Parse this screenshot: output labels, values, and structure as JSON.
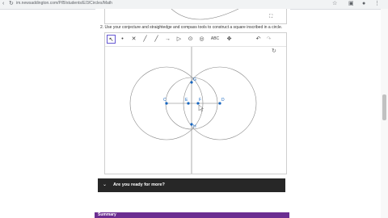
{
  "browser": {
    "url": "im.newsaddington.com/P/B/students/E/3/Circles/Math",
    "back_icon": "arrow-left-icon",
    "forward_icon": "arrow-right-icon",
    "reload_icon": "reload-icon"
  },
  "question": {
    "text": "2. Use your conjecture and straightedge and compass tools to construct a square inscribed in a circle."
  },
  "applet": {
    "tools": [
      {
        "name": "move-tool-icon",
        "glyph": "↖"
      },
      {
        "name": "point-tool-icon",
        "glyph": "•"
      },
      {
        "name": "intersect-tool-icon",
        "glyph": "✕"
      },
      {
        "name": "line-tool-icon",
        "glyph": "╱"
      },
      {
        "name": "segment-tool-icon",
        "glyph": "╱"
      },
      {
        "name": "ray-tool-icon",
        "glyph": "→"
      },
      {
        "name": "polygon-tool-icon",
        "glyph": "▷"
      },
      {
        "name": "circle-tool-icon",
        "glyph": "⊙"
      },
      {
        "name": "compass-tool-icon",
        "glyph": "◎"
      },
      {
        "name": "text-tool-icon",
        "glyph": "ABC"
      },
      {
        "name": "move-view-tool-icon",
        "glyph": "✥"
      }
    ],
    "undo_icon": "undo-icon",
    "redo_icon": "redo-icon",
    "refresh_icon": "refresh-icon",
    "fullscreen_icon": "fullscreen-icon",
    "points": [
      {
        "label": "C",
        "color": "#1565c0"
      },
      {
        "label": "E",
        "color": "#1565c0"
      },
      {
        "label": "F",
        "color": "#1565c0"
      },
      {
        "label": "D",
        "color": "#1565c0"
      },
      {
        "label": "G",
        "color": "#1565c0"
      },
      {
        "label": "H",
        "color": "#1565c0"
      }
    ]
  },
  "ready": {
    "label": "Are you ready for more?",
    "chevron_icon": "chevron-down-icon"
  },
  "summary": {
    "label": "Summary"
  },
  "colors": {
    "ready_bg": "#272727",
    "summary_bg": "#6b2d91",
    "tool_active": "#6557d2",
    "point": "#1565c0"
  }
}
